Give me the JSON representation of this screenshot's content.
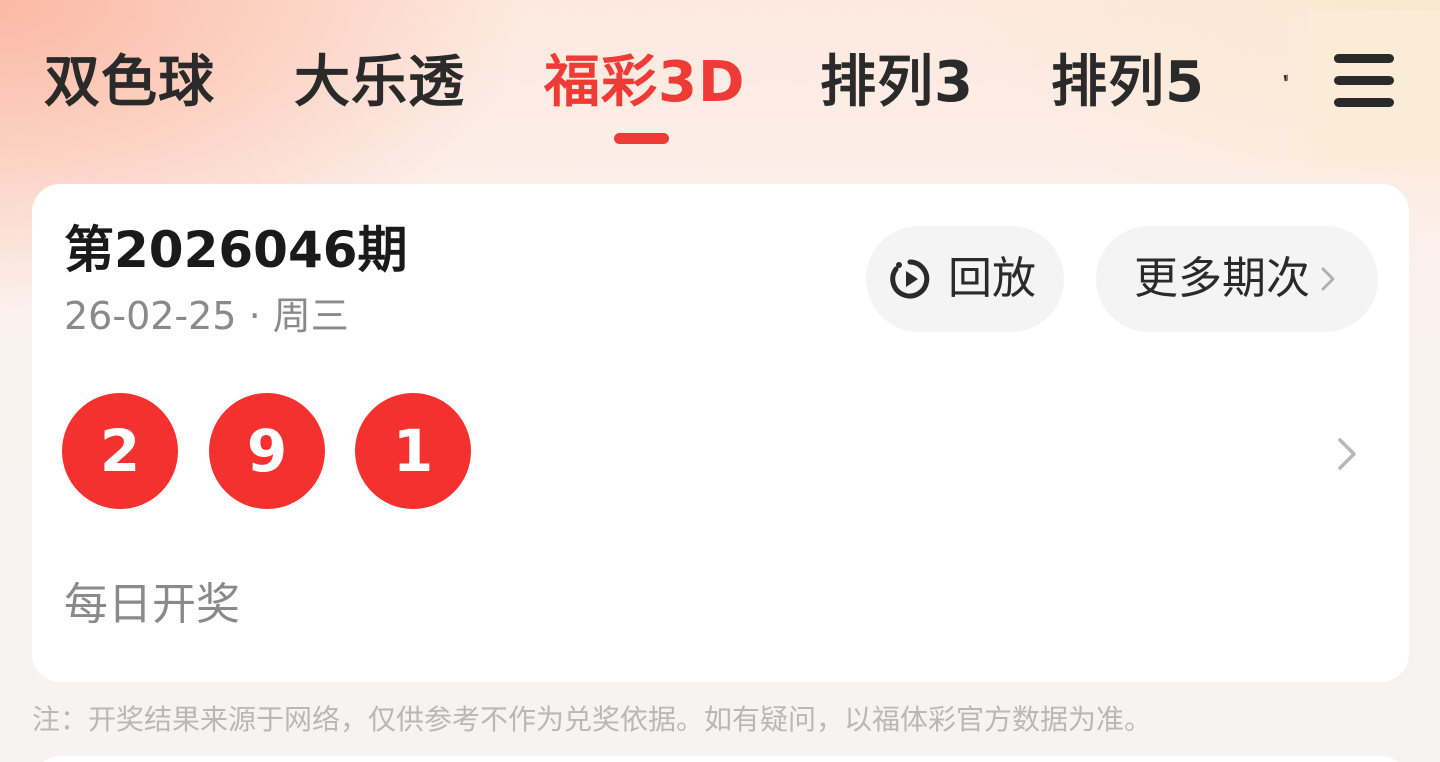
{
  "tabs": [
    {
      "label": "双色球"
    },
    {
      "label": "大乐透"
    },
    {
      "label": "福彩3D",
      "active": true
    },
    {
      "label": "排列3"
    },
    {
      "label": "排列5"
    },
    {
      "label": "七"
    }
  ],
  "menu": {
    "icon": "menu-icon"
  },
  "draw": {
    "issue": "第2026046期",
    "date": "26-02-25 · 周三",
    "replay_label": "回放",
    "replay_icon": "replay-timer-icon",
    "more_label": "更多期次",
    "numbers": [
      "2",
      "9",
      "1"
    ],
    "ball_color": "#f3312f",
    "frequency": "每日开奖"
  },
  "note": "注：开奖结果来源于网络，仅供参考不作为兑奖依据。如有疑问，以福体彩官方数据为准。",
  "colors": {
    "accent": "#ee3b36",
    "text": "#2a2a2a",
    "muted": "#8a8a8a"
  }
}
